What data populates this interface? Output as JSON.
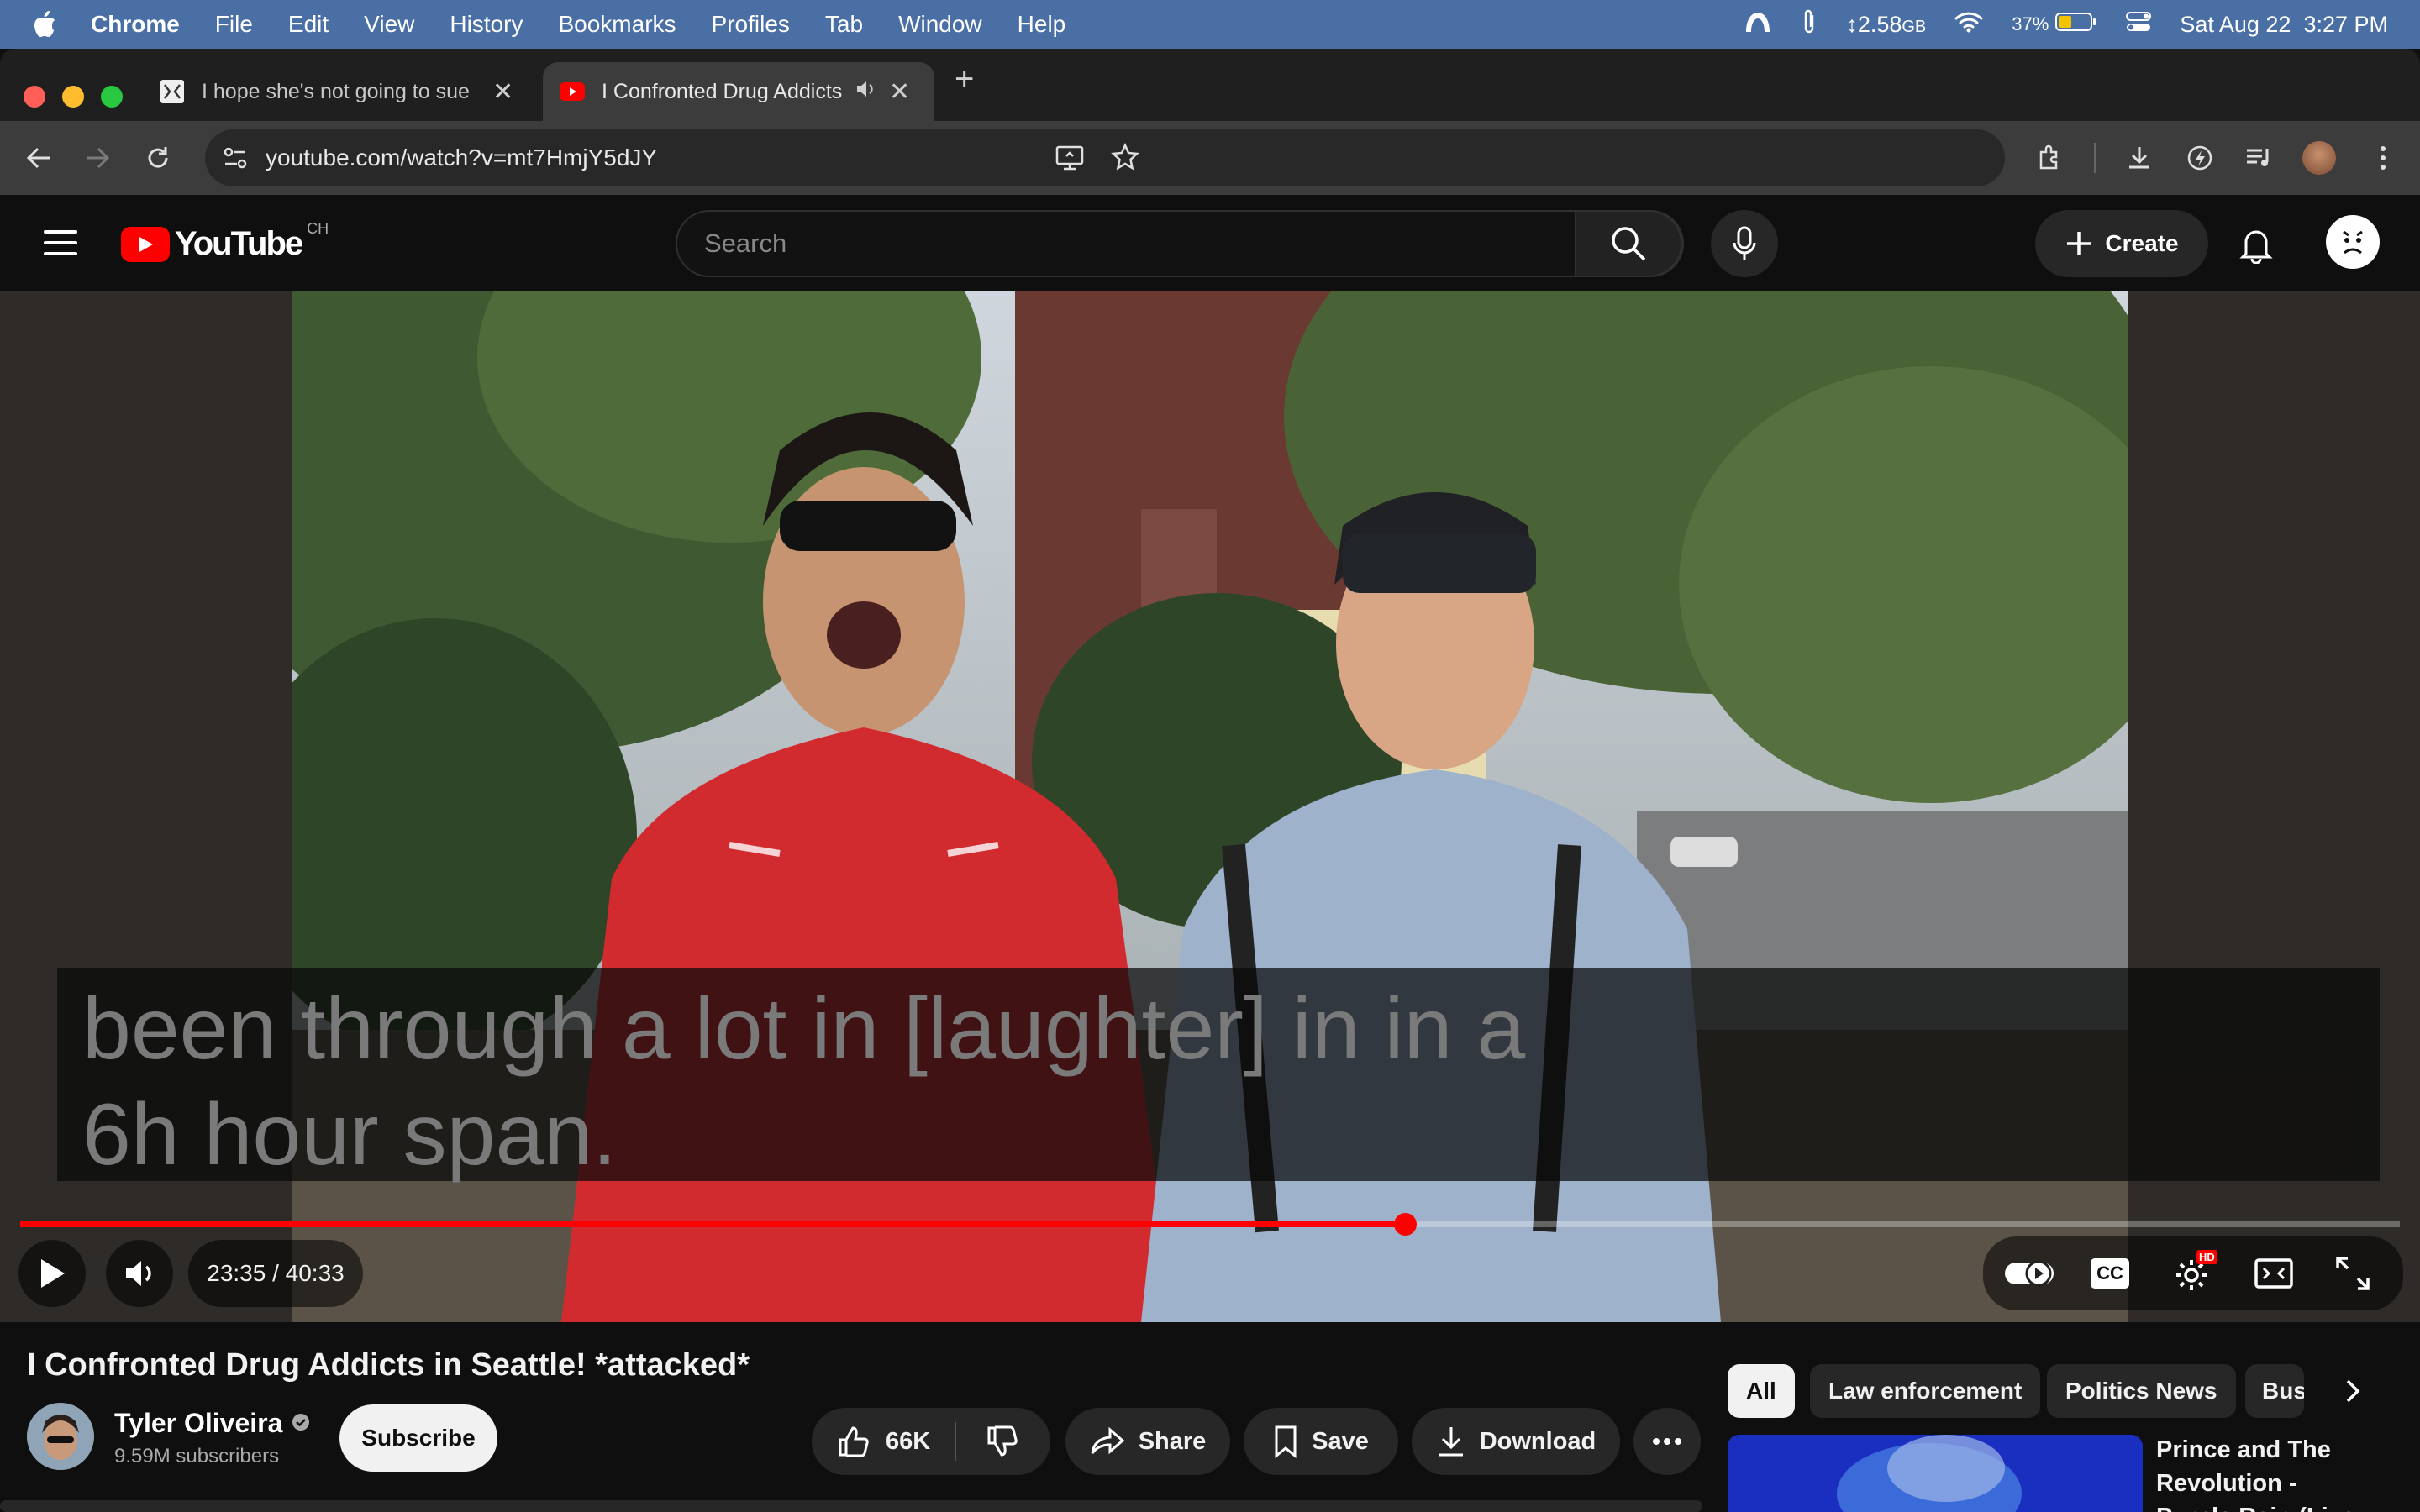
{
  "menubar": {
    "app": "Chrome",
    "items": [
      "File",
      "Edit",
      "View",
      "History",
      "Bookmarks",
      "Profiles",
      "Tab",
      "Window",
      "Help"
    ],
    "memory": "2.58",
    "memory_unit": "GB",
    "battery": "37%",
    "datetime": "Sat Aug 22  3:27 PM"
  },
  "browser": {
    "tabs": [
      {
        "title": "I hope she's not going to sue",
        "active": false
      },
      {
        "title": "I Confronted Drug Addicts",
        "active": true
      }
    ],
    "url": "youtube.com/watch?v=mt7HmjY5dJY"
  },
  "youtube": {
    "logo_text": "YouTube",
    "country": "CH",
    "search_placeholder": "Search",
    "create_label": "Create"
  },
  "player": {
    "caption_lines": [
      "been through a lot in [laughter] in in a",
      "6h hour span."
    ],
    "current_time": "23:35",
    "duration": "40:33",
    "time_display": "23:35 / 40:33",
    "progress": 0.582,
    "cc_label": "CC",
    "hd_badge": "HD"
  },
  "video": {
    "title": "I Confronted Drug Addicts in Seattle! *attacked*",
    "channel": "Tyler Oliveira",
    "subscribers": "9.59M subscribers",
    "subscribe_label": "Subscribe",
    "likes": "66K",
    "share_label": "Share",
    "save_label": "Save",
    "download_label": "Download"
  },
  "sidebar": {
    "chips": [
      {
        "label": "All",
        "active": true
      },
      {
        "label": "Law enforcement",
        "active": false
      },
      {
        "label": "Politics News",
        "active": false
      },
      {
        "label": "Bus",
        "active": false
      }
    ],
    "recommendation_title": "Prince and The Revolution - Purple Rain (Live in Sy"
  },
  "colors": {
    "accent": "#ff0000",
    "menubar": "#4a6fa5",
    "background": "#0f0f0f"
  }
}
